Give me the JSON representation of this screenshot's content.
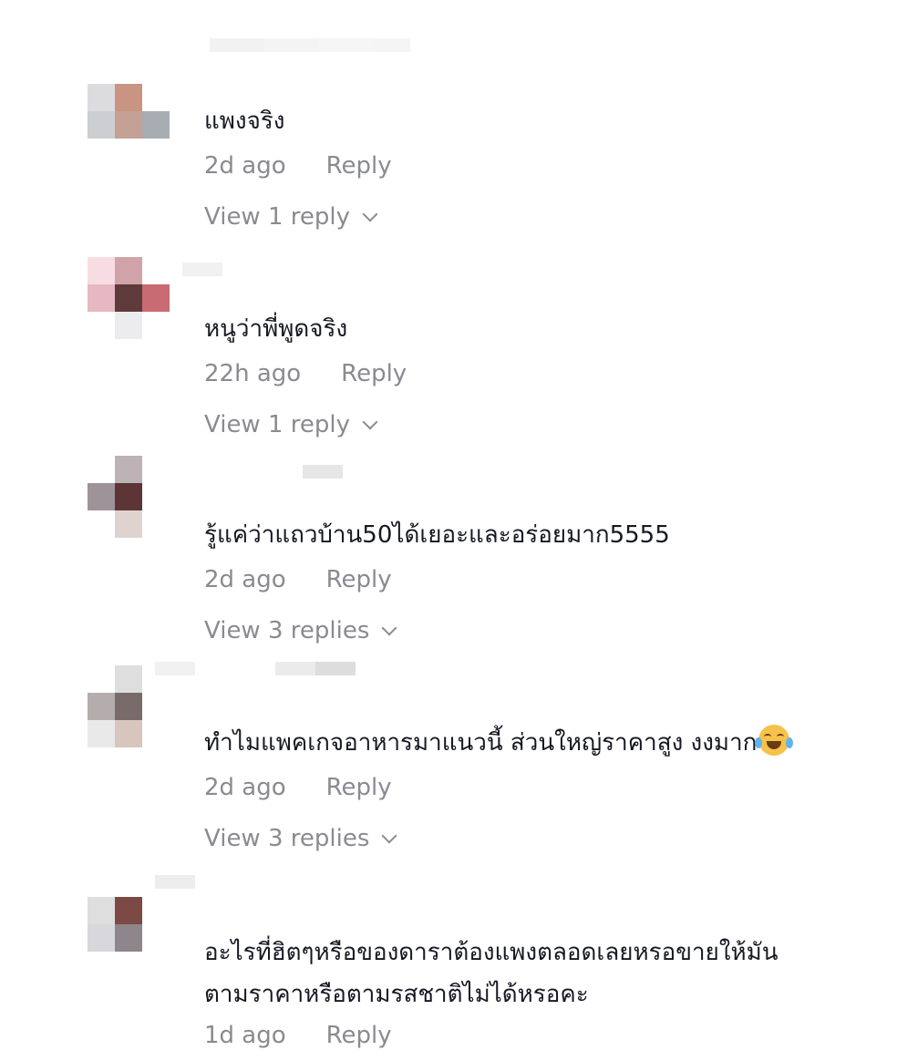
{
  "comments": [
    {
      "text_lines": [
        "แพงจริง"
      ],
      "time": "2d ago",
      "reply_label": "Reply",
      "view_replies": "View 1 reply",
      "emoji": ""
    },
    {
      "text_lines": [
        "หนูว่าพี่พูดจริง"
      ],
      "time": "22h ago",
      "reply_label": "Reply",
      "view_replies": "View 1 reply",
      "emoji": ""
    },
    {
      "text_lines": [
        "รู้แค่ว่าแถวบ้าน50ได้เยอะและอร่อยมาก5555"
      ],
      "time": "2d ago",
      "reply_label": "Reply",
      "view_replies": "View 3 replies",
      "emoji": ""
    },
    {
      "text_lines": [
        "ทำไมแพคเกจอาหารมาแนวนี้ ส่วนใหญ่ราคาสูง งงมาก"
      ],
      "time": "2d ago",
      "reply_label": "Reply",
      "view_replies": "View 3 replies",
      "emoji": "face-with-tears-of-joy"
    },
    {
      "text_lines": [
        "อะไรที่ฮิตๆหรือของดาราต้องแพงตลอดเลยหรอขายให้มัน",
        "ตามราคาหรือตามรสชาติไม่ได้หรอคะ"
      ],
      "time": "1d ago",
      "reply_label": "Reply",
      "view_replies": "",
      "emoji": ""
    }
  ],
  "colors": {
    "text": "#161823",
    "meta": "#8a8b91",
    "avatars": [
      [
        "#ffffff",
        "#ffffff",
        "#ffffff",
        "#dcdcde",
        "#c99482",
        "#ffffff",
        "#cdced2",
        "#c5a095",
        "#a8acb3"
      ],
      [
        "#f8dce3",
        "#cfa3a9",
        "#ffffff",
        "#e5b8c2",
        "#5e3b3a",
        "#c96b72",
        "#ffffff",
        "#ececee",
        "#ffffff"
      ],
      [
        "#ffffff",
        "#bdb3b6",
        "#ffffff",
        "#9e9398",
        "#5d3536",
        "#ffffff",
        "#ffffff",
        "#dfd3cf",
        "#ffffff"
      ],
      [
        "#ffffff",
        "#dedede",
        "#ffffff",
        "#b5adad",
        "#7a6b6b",
        "#ffffff",
        "#e9e9ea",
        "#d8c5bd",
        "#ffffff"
      ],
      [
        "#ffffff",
        "#ffffff",
        "#ffffff",
        "#dededf",
        "#7c4a45",
        "#ffffff",
        "#d8d8dc",
        "#8f868c",
        "#ffffff"
      ]
    ]
  }
}
